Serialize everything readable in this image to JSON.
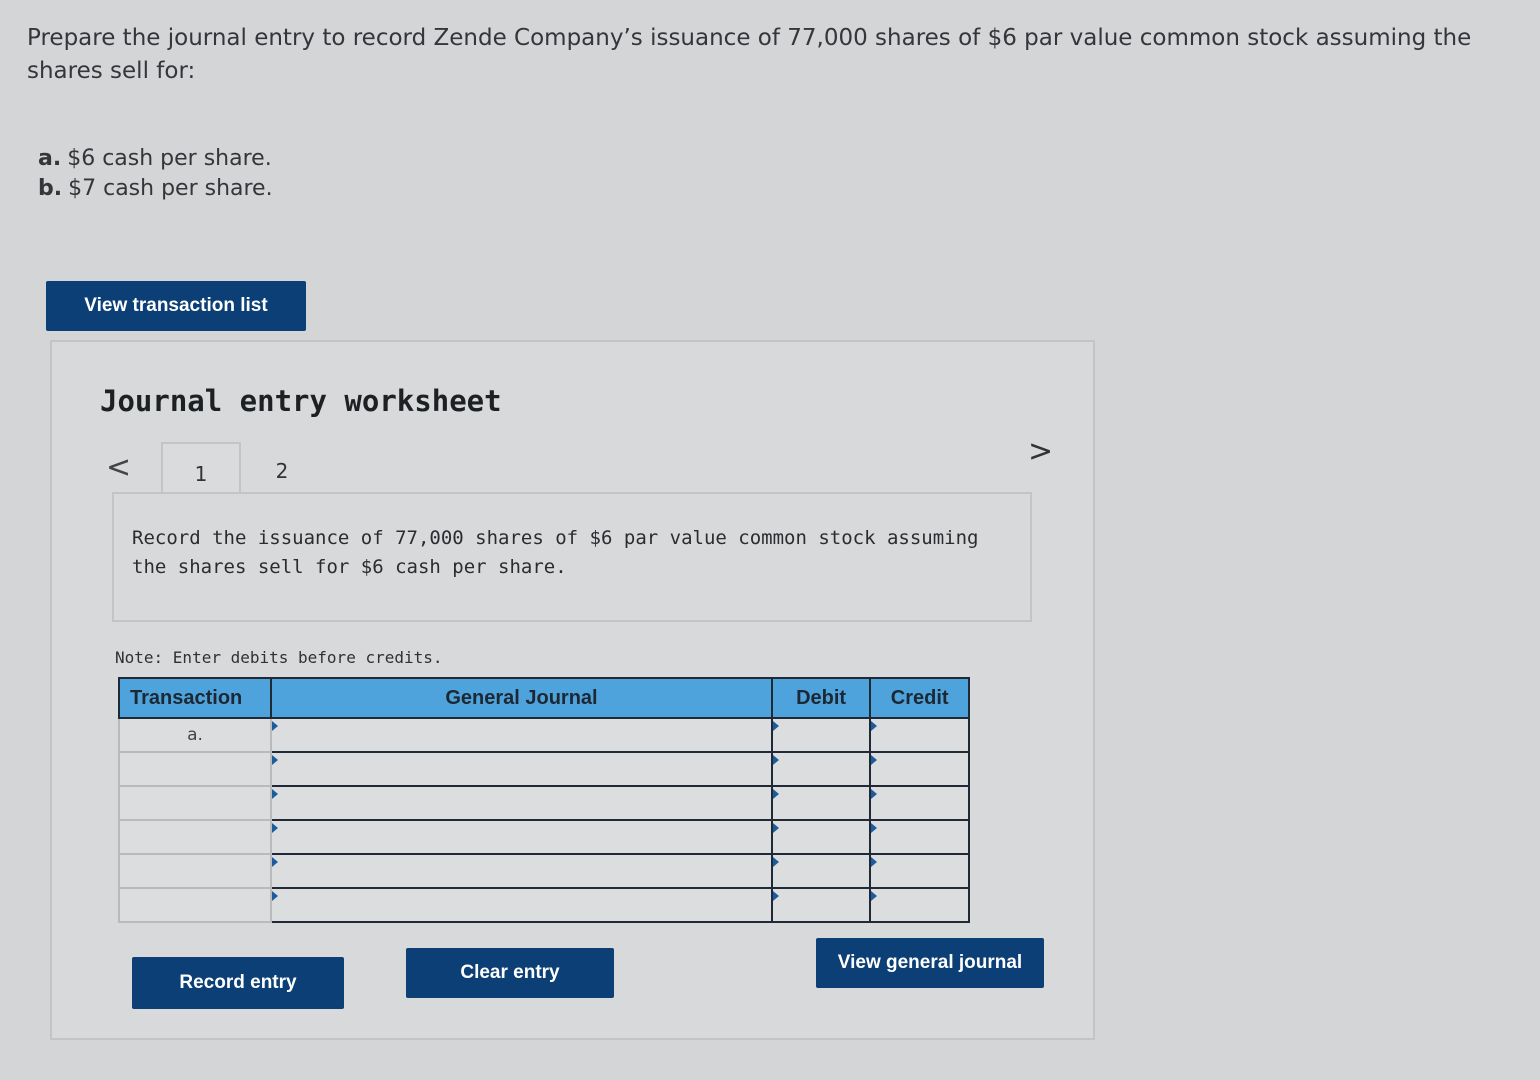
{
  "question": {
    "text": "Prepare the journal entry to record Zende Company’s issuance of 77,000 shares of $6 par value common stock assuming the shares sell for:",
    "options": [
      {
        "label": "a.",
        "text": "$6 cash per share."
      },
      {
        "label": "b.",
        "text": "$7 cash per share."
      }
    ]
  },
  "buttons": {
    "view_transaction_list": "View transaction list",
    "record_entry": "Record entry",
    "clear_entry": "Clear entry",
    "view_general_journal": "View general journal"
  },
  "worksheet": {
    "title": "Journal entry worksheet",
    "nav_prev": "<",
    "nav_next": ">",
    "tabs": [
      "1",
      "2"
    ],
    "active_tab": "1",
    "prompt": "Record the issuance of 77,000 shares of $6 par value common stock assuming the shares sell for $6 cash per share.",
    "note": "Note: Enter debits before credits."
  },
  "journal_table": {
    "headers": {
      "transaction": "Transaction",
      "general_journal": "General Journal",
      "debit": "Debit",
      "credit": "Credit"
    },
    "rows": [
      {
        "transaction": "a.",
        "general_journal": "",
        "debit": "",
        "credit": ""
      },
      {
        "transaction": "",
        "general_journal": "",
        "debit": "",
        "credit": ""
      },
      {
        "transaction": "",
        "general_journal": "",
        "debit": "",
        "credit": ""
      },
      {
        "transaction": "",
        "general_journal": "",
        "debit": "",
        "credit": ""
      },
      {
        "transaction": "",
        "general_journal": "",
        "debit": "",
        "credit": ""
      },
      {
        "transaction": "",
        "general_journal": "",
        "debit": "",
        "credit": ""
      }
    ]
  }
}
